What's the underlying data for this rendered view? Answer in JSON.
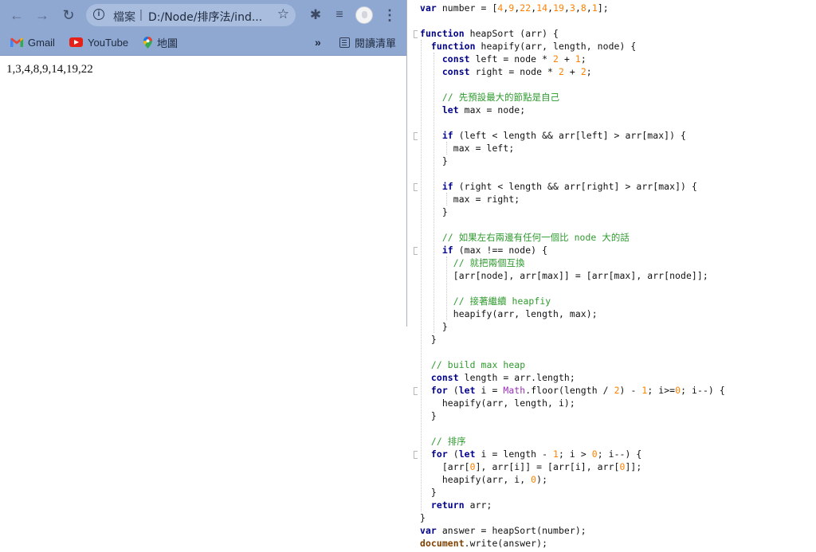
{
  "browser": {
    "address_bar": {
      "scheme_label": "檔案",
      "separator": "|",
      "url": "D:/Node/排序法/ind..."
    },
    "bookmarks": {
      "items": [
        {
          "label": "Gmail",
          "icon": "gmail-icon"
        },
        {
          "label": "YouTube",
          "icon": "youtube-icon"
        },
        {
          "label": "地圖",
          "icon": "maps-icon"
        }
      ],
      "overflow": "»",
      "reading_list": "閱讀清單"
    },
    "icons": {
      "back": "←",
      "forward": "→",
      "reload": "↻",
      "star": "☆",
      "extensions": "✱",
      "media": "≡",
      "menu": "⋮",
      "info": "i"
    },
    "colors": {
      "toolbar": "#8fa8d2",
      "omnibox": "#a9bddf"
    },
    "page_output": "1,3,4,8,9,14,19,22"
  },
  "editor": {
    "colors": {
      "keyword": "#00008b",
      "number": "#ff8000",
      "comment": "#2e9a2e",
      "builtin": "#9b30b8"
    },
    "lines": [
      "var number = [4,9,22,14,19,3,8,1];",
      "",
      "function heapSort (arr) {",
      "  function heapify(arr, length, node) {",
      "    const left = node * 2 + 1;",
      "    const right = node * 2 + 2;",
      "",
      "    // 先預設最大的節點是自己",
      "    let max = node;",
      "",
      "    if (left < length && arr[left] > arr[max]) {",
      "      max = left;",
      "    }",
      "",
      "    if (right < length && arr[right] > arr[max]) {",
      "      max = right;",
      "    }",
      "",
      "    // 如果左右兩邊有任何一個比 node 大的話",
      "    if (max !== node) {",
      "      // 就把兩個互換",
      "      [arr[node], arr[max]] = [arr[max], arr[node]];",
      "",
      "      // 接著繼續 heapfiy",
      "      heapify(arr, length, max);",
      "    }",
      "  }",
      "",
      "  // build max heap",
      "  const length = arr.length;",
      "  for (let i = Math.floor(length / 2) - 1; i>=0; i--) {",
      "    heapify(arr, length, i);",
      "  }",
      "",
      "  // 排序",
      "  for (let i = length - 1; i > 0; i--) {",
      "    [arr[0], arr[i]] = [arr[i], arr[0]];",
      "    heapify(arr, i, 0);",
      "  }",
      "  return arr;",
      "}",
      "var answer = heapSort(number);",
      "document.write(answer);"
    ]
  }
}
